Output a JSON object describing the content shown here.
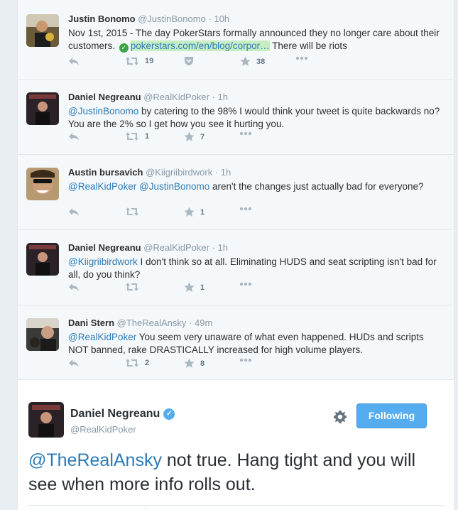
{
  "colors": {
    "link": "#2b7bb9",
    "link_highlight": "#c6eec2",
    "verified_badge": "#55acee",
    "follow_button": "#55acee",
    "thread_background": "#f5f8fa",
    "page_background": "#e8eef2"
  },
  "tweets": [
    {
      "name": "Justin Bonomo",
      "handle": "@JustinBonomo",
      "sep": "·",
      "time": "10h",
      "text_before": "Nov 1st, 2015 - The day PokerStars formally announced they no longer care about their customers. ",
      "link_icon": "check-circle-icon",
      "link": "pokerstars.com/en/blog/corpor…",
      "text_after": " There will be riots",
      "retweets": "19",
      "favorites": "38",
      "pocket_icon": "pocket-icon"
    },
    {
      "name": "Daniel Negreanu",
      "handle": "@RealKidPoker",
      "sep": "·",
      "time": "1h",
      "mention": "@JustinBonomo",
      "text": " by catering to the 98% I would think your tweet is quite backwards no? You are the 2% so I get how you see it hurting you.",
      "retweets": "1",
      "favorites": "7"
    },
    {
      "name": "Austin bursavich",
      "handle": "@Kiigriibirdwork",
      "sep": "·",
      "time": "1h",
      "mention": "@RealKidPoker",
      "mention2": "@JustinBonomo",
      "text": " aren't the changes just actually bad for everyone?",
      "retweets": "",
      "favorites": "1"
    },
    {
      "name": "Daniel Negreanu",
      "handle": "@RealKidPoker",
      "sep": "·",
      "time": "1h",
      "mention": "@Kiigriibirdwork",
      "text": " I don't think so at all. Eliminating HUDS and seat scripting isn't bad for all, do you think?",
      "retweets": "",
      "favorites": "1"
    },
    {
      "name": "Dani Stern",
      "handle": "@TheRealAnsky",
      "sep": "·",
      "time": "49m",
      "mention": "@RealKidPoker",
      "text": " You seem very unaware of what even happened. HUDs and scripts NOT banned, rake DRASTICALLY increased for high volume players.",
      "retweets": "2",
      "favorites": "8"
    }
  ],
  "icons": {
    "reply": "reply-icon",
    "retweet": "retweet-icon",
    "favorite": "star-icon",
    "more": "more-dots-icon"
  },
  "expanded": {
    "name": "Daniel Negreanu",
    "handle": "@RealKidPoker",
    "verified_icon": "verified-badge-icon",
    "settings_icon": "gear-icon",
    "follow_label": "Following",
    "mention": "@TheRealAnsky",
    "text": " not true. Hang tight and you will see when more info rolls out."
  }
}
